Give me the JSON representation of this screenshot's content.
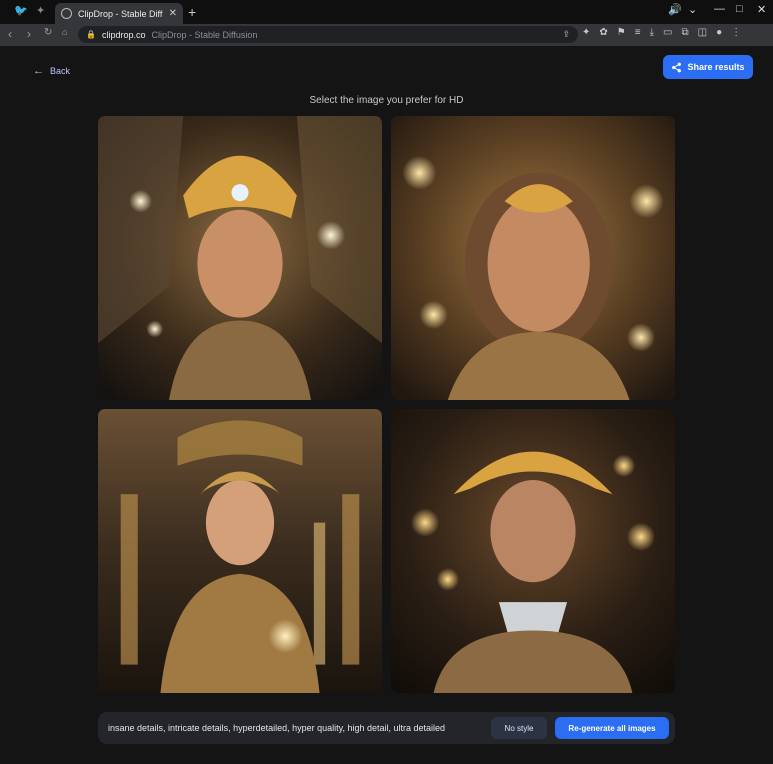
{
  "browser": {
    "tab_title": "ClipDrop - Stable Diffusion",
    "new_tab_icon": "+",
    "url_host": "clipdrop.co",
    "url_title": "ClipDrop - Stable Diffusion"
  },
  "page": {
    "back_label": "Back",
    "share_label": "Share results",
    "instruction": "Select the image you prefer for HD",
    "prompt_text": "insane details, intricate details, hyperdetailed, hyper quality, high detail, ultra detailed",
    "no_style_label": "No style",
    "regenerate_label": "Re-generate all images"
  },
  "images": [
    {
      "id": "image-1",
      "description_icon": "generated-image-icon"
    },
    {
      "id": "image-2",
      "description_icon": "generated-image-icon"
    },
    {
      "id": "image-3",
      "description_icon": "generated-image-icon"
    },
    {
      "id": "image-4",
      "description_icon": "generated-image-icon"
    }
  ],
  "colors": {
    "accent": "#2b6df3",
    "background": "#141414",
    "gold": "#d9a341"
  }
}
